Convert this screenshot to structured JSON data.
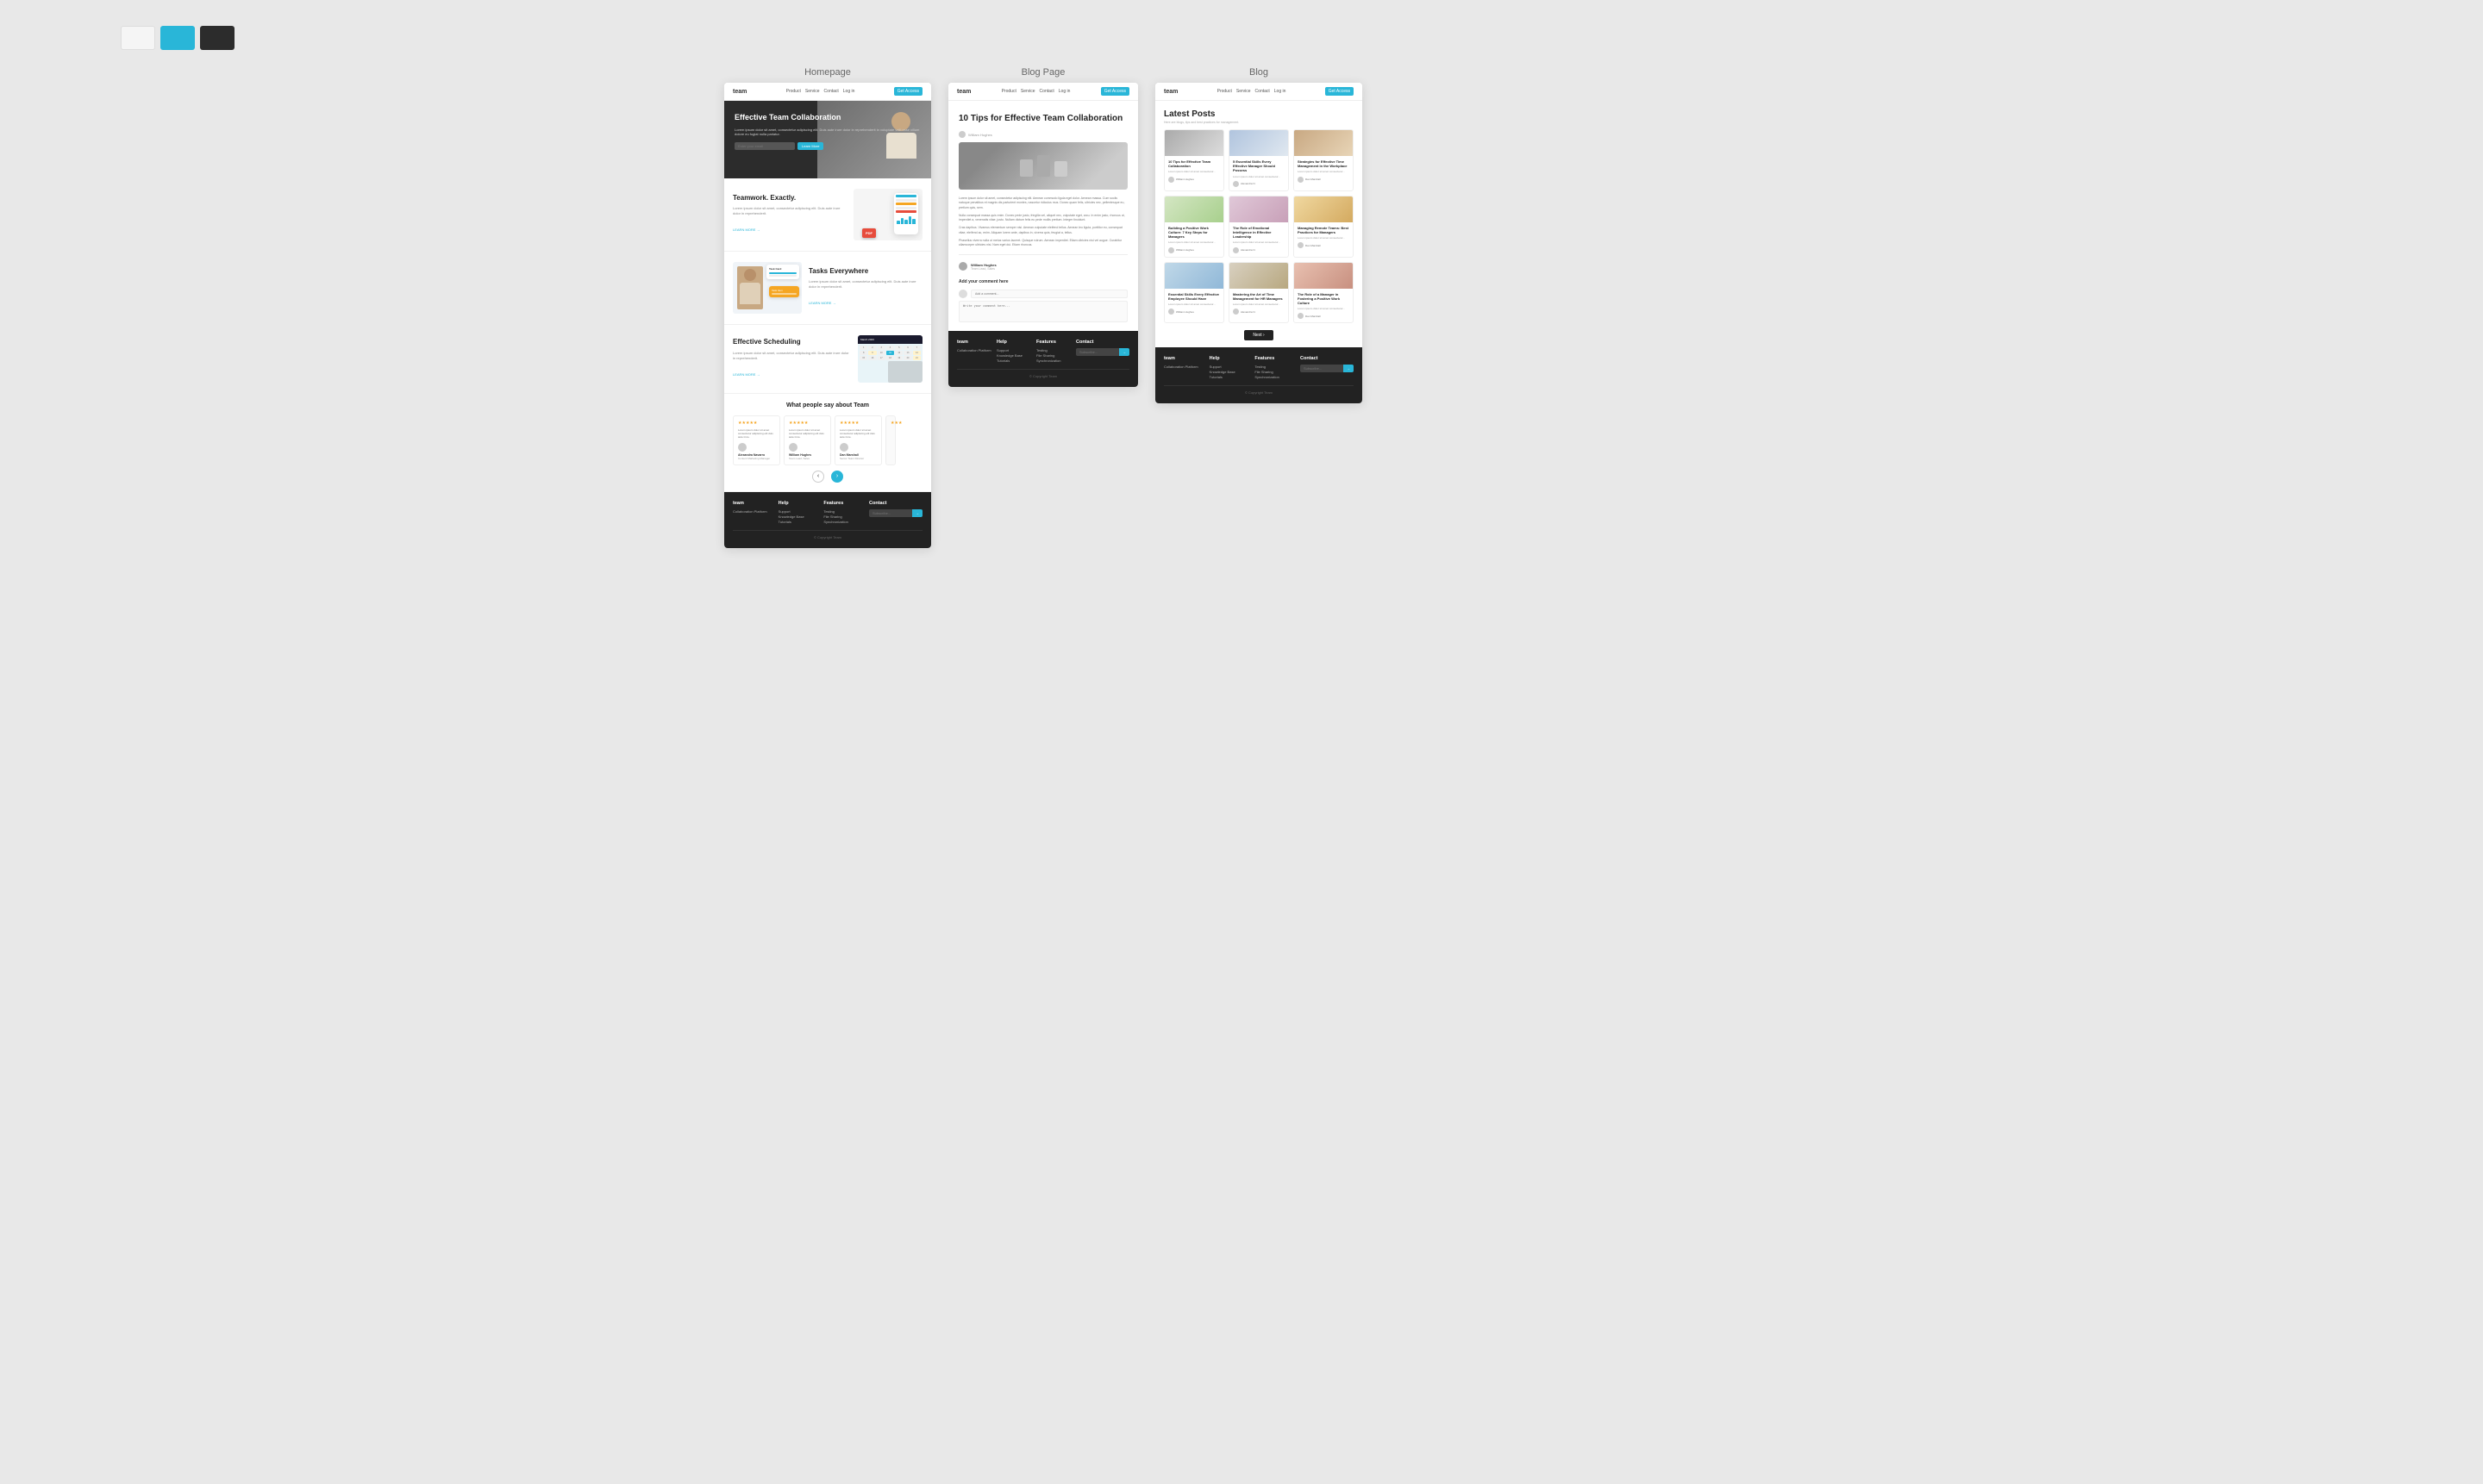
{
  "colors": {
    "swatch1": "#f5f5f5",
    "swatch2": "#29b6d8",
    "swatch3": "#2c2c2c"
  },
  "panels": {
    "homepage": {
      "label": "Homepage",
      "navbar": {
        "logo": "team",
        "links": [
          "Product",
          "Service",
          "Contact",
          "Log in"
        ],
        "cta": "Get Access"
      },
      "hero": {
        "title": "Effective Team Collaboration",
        "subtitle": "Lorem ipsum dolor sit amet, consectetur adipiscing elit. Duis aute irure dolor in reprehenderit in voluptate velit esse cillum dolore eu fugiat nulla pariatur.",
        "input_placeholder": "Enter your email",
        "cta": "Learn More"
      },
      "features": [
        {
          "title": "Teamwork. Exactly.",
          "body": "Lorem ipsum dolor sit amet, consectetur adipiscing elit. Duis aute irure dolor in reprehenderit.",
          "link": "LEARN MORE →"
        },
        {
          "title": "Tasks Everywhere",
          "body": "Lorem ipsum dolor sit amet, consectetur adipiscing elit. Duis aute irure dolor in reprehenderit.",
          "link": "LEARN MORE →"
        },
        {
          "title": "Effective Scheduling",
          "body": "Lorem ipsum dolor sit amet, consectetur adipiscing elit. Duis aute irure dolor in reprehenderit.",
          "link": "LEARN MORE →"
        }
      ],
      "testimonials": {
        "title": "What people say about Team",
        "cards": [
          {
            "stars": "★★★★★",
            "text": "Lorem ipsum dolor sit amet consectetur adipiscing elit duis aute irure.",
            "name": "Alexandra Navarro",
            "role": "Content Marketing Manager"
          },
          {
            "stars": "★★★★★",
            "text": "Lorem ipsum dolor sit amet consectetur adipiscing elit duis aute irure.",
            "name": "William Hughes",
            "role": "Team Lead, Sales"
          },
          {
            "stars": "★★★★★",
            "text": "Lorem ipsum dolor sit amet consectetur adipiscing elit duis aute irure.",
            "name": "Dan Marshall",
            "role": "Senior Team Director"
          }
        ]
      },
      "footer": {
        "logo": "team",
        "tagline": "Collaboration Platform",
        "help": {
          "title": "Help",
          "links": [
            "Support",
            "Knowledge Base",
            "Tutorials"
          ]
        },
        "features": {
          "title": "Features",
          "links": [
            "Testing",
            "File Sharing",
            "Synchronization"
          ]
        },
        "contact": {
          "title": "Contact",
          "newsletter_placeholder": "Subscribe to our newsletter"
        },
        "copyright": "© Copyright Team"
      }
    },
    "blog_page": {
      "label": "Blog Page",
      "navbar": {
        "logo": "team",
        "links": [
          "Product",
          "Service",
          "Contact",
          "Log in"
        ],
        "cta": "Get Access"
      },
      "article": {
        "tag": "●",
        "title": "10 Tips for Effective Team Collaboration",
        "body_paragraphs": [
          "Lorem ipsum dolor sit amet, consectetur adipiscing elit. Aenean commodo ligula eget dolor. Aenean massa. Cum sociis natoque penatibus et magnis dis parturient montes, nascetur ridiculus mus. Donec quam felis, ultricies nec, pellentesque eu, pretium quis, sem.",
          "Nulla consequat massa quis enim. Donec pede justo, fringilla vel, aliquet nec, vulputate eget, arcu. In enim justo, rhoncus ut, imperdiet a, venenatis vitae, justo. Nullam dictum felis eu pede mollis pretium. Integer tincidunt.",
          "Cras dapibus. Vivamus elementum semper nisi. Aenean vulputate eleifend tellus. Aenean leo ligula, porttitor eu, consequat vitae, eleifend ac, enim. Aliquam lorem ante, dapibus in, viverra quis, feugiat a, tellus.",
          "Phasellus viverra nulla ut metus varius laoreet. Quisque rutrum. Aenean imperdiet. Etiam ultricies nisi vel augue. Curabitur ullamcorper ultricies nisi. Nam eget dui. Etiam rhoncus."
        ],
        "author_name": "William Hughes",
        "author_role": "Team Lead, Sales"
      },
      "comment_section": {
        "title": "Add your comment here",
        "input_placeholder": "Add a comment...",
        "textarea_placeholder": "Write your comment here..."
      }
    },
    "blog": {
      "label": "Blog",
      "navbar": {
        "logo": "team",
        "links": [
          "Product",
          "Service",
          "Contact",
          "Log in"
        ],
        "cta": "Get Access"
      },
      "header": {
        "title": "Latest Posts",
        "subtitle": "Here are blogs, tips and best practices for management."
      },
      "posts": [
        {
          "title": "10 Tips for Effective Team Collaboration",
          "text": "Lorem ipsum dolor sit amet consectetur...",
          "author": "William Hughes",
          "img_class": "blog-card-img-1"
        },
        {
          "title": "5 Essential Skills Every Effective Manager Should Possess",
          "text": "Lorem ipsum dolor sit amet consectetur...",
          "author": "Alexandra N.",
          "img_class": "blog-card-img-2"
        },
        {
          "title": "Strategies for Effective Time Management in the Workplace",
          "text": "Lorem ipsum dolor sit amet consectetur...",
          "author": "Dan Marshall",
          "img_class": "blog-card-img-3"
        },
        {
          "title": "Building a Positive Work Culture: 7 Key Steps for Managers",
          "text": "Lorem ipsum dolor sit amet consectetur...",
          "author": "William Hughes",
          "img_class": "blog-card-img-4"
        },
        {
          "title": "The Role of Emotional Intelligence in Effective Leadership",
          "text": "Lorem ipsum dolor sit amet consectetur...",
          "author": "Alexandra N.",
          "img_class": "blog-card-img-5"
        },
        {
          "title": "Managing Remote Teams: Best Practices for Managers",
          "text": "Lorem ipsum dolor sit amet consectetur...",
          "author": "Dan Marshall",
          "img_class": "blog-card-img-6"
        },
        {
          "title": "Essential Skills Every Effective Employee Should Have",
          "text": "Lorem ipsum dolor sit amet consectetur...",
          "author": "William Hughes",
          "img_class": "blog-card-img-7"
        },
        {
          "title": "Mastering the Art of Time Management for HR Managers",
          "text": "Lorem ipsum dolor sit amet consectetur...",
          "author": "Alexandra N.",
          "img_class": "blog-card-img-8"
        },
        {
          "title": "The Role of a Manager in Fostering a Positive Work Culture",
          "text": "Lorem ipsum dolor sit amet consectetur...",
          "author": "Dan Marshall",
          "img_class": "blog-card-img-9"
        }
      ],
      "pagination": {
        "next_label": "Next ›"
      },
      "footer": {
        "logo": "team",
        "tagline": "Collaboration Platform",
        "copyright": "© Copyright Team"
      }
    }
  }
}
